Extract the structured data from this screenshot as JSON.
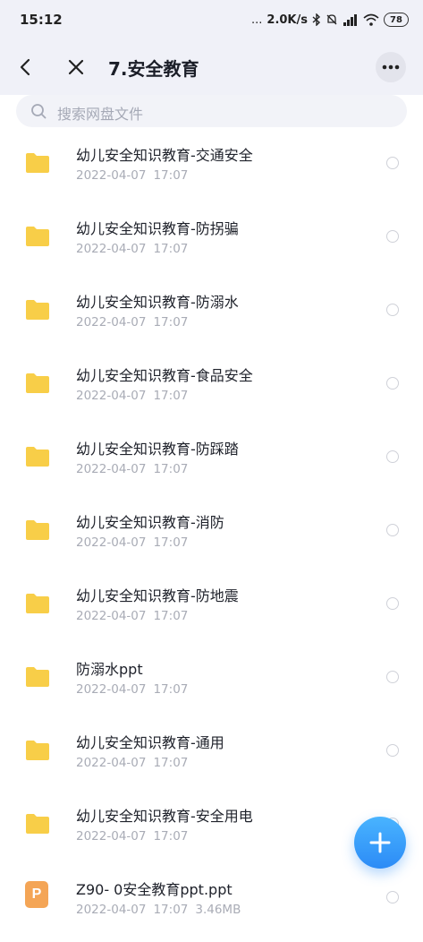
{
  "status_bar": {
    "time": "15:12",
    "dots": "...",
    "speed": "2.0K/s",
    "battery": "78"
  },
  "header": {
    "title": "7.安全教育"
  },
  "search": {
    "placeholder": "搜索网盘文件"
  },
  "files": [
    {
      "name": "幼儿安全知识教育-交通安全",
      "date": "2022-04-07",
      "time": "17:07",
      "size": "",
      "type": "folder"
    },
    {
      "name": "幼儿安全知识教育-防拐骗",
      "date": "2022-04-07",
      "time": "17:07",
      "size": "",
      "type": "folder"
    },
    {
      "name": "幼儿安全知识教育-防溺水",
      "date": "2022-04-07",
      "time": "17:07",
      "size": "",
      "type": "folder"
    },
    {
      "name": "幼儿安全知识教育-食品安全",
      "date": "2022-04-07",
      "time": "17:07",
      "size": "",
      "type": "folder"
    },
    {
      "name": "幼儿安全知识教育-防踩踏",
      "date": "2022-04-07",
      "time": "17:07",
      "size": "",
      "type": "folder"
    },
    {
      "name": "幼儿安全知识教育-消防",
      "date": "2022-04-07",
      "time": "17:07",
      "size": "",
      "type": "folder"
    },
    {
      "name": "幼儿安全知识教育-防地震",
      "date": "2022-04-07",
      "time": "17:07",
      "size": "",
      "type": "folder"
    },
    {
      "name": "防溺水ppt",
      "date": "2022-04-07",
      "time": "17:07",
      "size": "",
      "type": "folder"
    },
    {
      "name": "幼儿安全知识教育-通用",
      "date": "2022-04-07",
      "time": "17:07",
      "size": "",
      "type": "folder"
    },
    {
      "name": "幼儿安全知识教育-安全用电",
      "date": "2022-04-07",
      "time": "17:07",
      "size": "",
      "type": "folder"
    },
    {
      "name": "Z90- 0安全教育ppt.ppt",
      "date": "2022-04-07",
      "time": "17:07",
      "size": "3.46MB",
      "type": "ppt",
      "icon_letter": "P"
    }
  ],
  "colors": {
    "header_bg": "#f0f1f8",
    "folder": "#f8ce48",
    "ppt": "#f4a556",
    "fab": "#2c8bf6"
  }
}
